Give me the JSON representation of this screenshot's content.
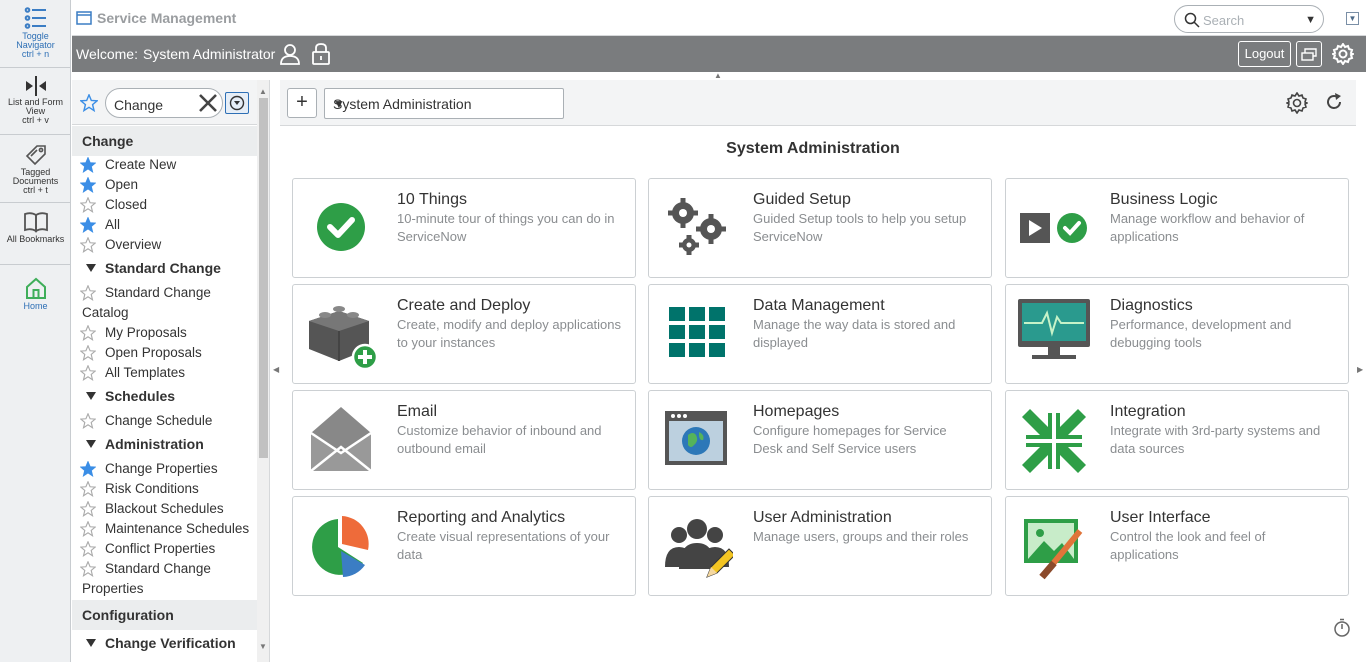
{
  "rail": {
    "toggle": {
      "label": "Toggle Navigator",
      "shortcut": "ctrl + n"
    },
    "listform": {
      "label": "List and Form View",
      "shortcut": "ctrl + v"
    },
    "tagged": {
      "label": "Tagged Documents",
      "shortcut": "ctrl + t"
    },
    "bookmarks": {
      "label": "All Bookmarks"
    },
    "home": {
      "label": "Home"
    }
  },
  "header": {
    "title": "Service Management",
    "search_placeholder": "Search",
    "welcome_label": "Welcome:",
    "user_name": "System Administrator",
    "logout_label": "Logout"
  },
  "navigator": {
    "filter_value": "Change",
    "sections": [
      {
        "label": "Change"
      },
      {
        "label": "Configuration"
      }
    ],
    "items": [
      {
        "label": "Create New",
        "starred": true
      },
      {
        "label": "Open",
        "starred": true
      },
      {
        "label": "Closed",
        "starred": false
      },
      {
        "label": "All",
        "starred": true
      },
      {
        "label": "Overview",
        "starred": false
      }
    ],
    "standard_change": {
      "label": "Standard Change",
      "items": [
        {
          "label": "Standard Change",
          "label2": "Catalog",
          "starred": false
        },
        {
          "label": "My Proposals",
          "starred": false
        },
        {
          "label": "Open Proposals",
          "starred": false
        },
        {
          "label": "All Templates",
          "starred": false
        }
      ]
    },
    "schedules": {
      "label": "Schedules",
      "items": [
        {
          "label": "Change Schedule",
          "starred": false
        }
      ]
    },
    "administration": {
      "label": "Administration",
      "items": [
        {
          "label": "Change Properties",
          "starred": true
        },
        {
          "label": "Risk Conditions",
          "starred": false
        },
        {
          "label": "Blackout Schedules",
          "starred": false
        },
        {
          "label": "Maintenance Schedules",
          "starred": false
        },
        {
          "label": "Conflict Properties",
          "starred": false
        },
        {
          "label": "Standard Change",
          "label2": "Properties",
          "starred": false
        }
      ]
    },
    "change_verification": {
      "label": "Change Verification"
    }
  },
  "content": {
    "app_select_value": "System Administration",
    "page_title": "System Administration",
    "cards": [
      {
        "title": "10 Things",
        "desc": "10-minute tour of things you can do in ServiceNow",
        "icon": "checkmark-circle-icon"
      },
      {
        "title": "Guided Setup",
        "desc": "Guided Setup tools to help you setup ServiceNow",
        "icon": "gears-icon"
      },
      {
        "title": "Business Logic",
        "desc": "Manage workflow and behavior of applications",
        "icon": "play-check-icon"
      },
      {
        "title": "Create and Deploy",
        "desc": "Create, modify and deploy applications to your instances",
        "icon": "blocks-add-icon"
      },
      {
        "title": "Data Management",
        "desc": "Manage the way data is stored and displayed",
        "icon": "grid-icon"
      },
      {
        "title": "Diagnostics",
        "desc": "Performance, development and debugging tools",
        "icon": "monitor-pulse-icon"
      },
      {
        "title": "Email",
        "desc": "Customize behavior of inbound and outbound email",
        "icon": "envelope-icon"
      },
      {
        "title": "Homepages",
        "desc": "Configure homepages for Service Desk and Self Service users",
        "icon": "browser-globe-icon"
      },
      {
        "title": "Integration",
        "desc": "Integrate with 3rd-party systems and data sources",
        "icon": "arrows-inward-icon"
      },
      {
        "title": "Reporting and Analytics",
        "desc": "Create visual representations of your data",
        "icon": "pie-chart-icon"
      },
      {
        "title": "User Administration",
        "desc": "Manage users, groups and their roles",
        "icon": "users-pencil-icon"
      },
      {
        "title": "User Interface",
        "desc": "Control the look and feel of applications",
        "icon": "image-brush-icon"
      }
    ]
  },
  "colors": {
    "accent_green": "#2e9e47",
    "teal": "#00736b",
    "star_blue": "#3b8ee6",
    "header_gray": "#7a7c7e"
  }
}
